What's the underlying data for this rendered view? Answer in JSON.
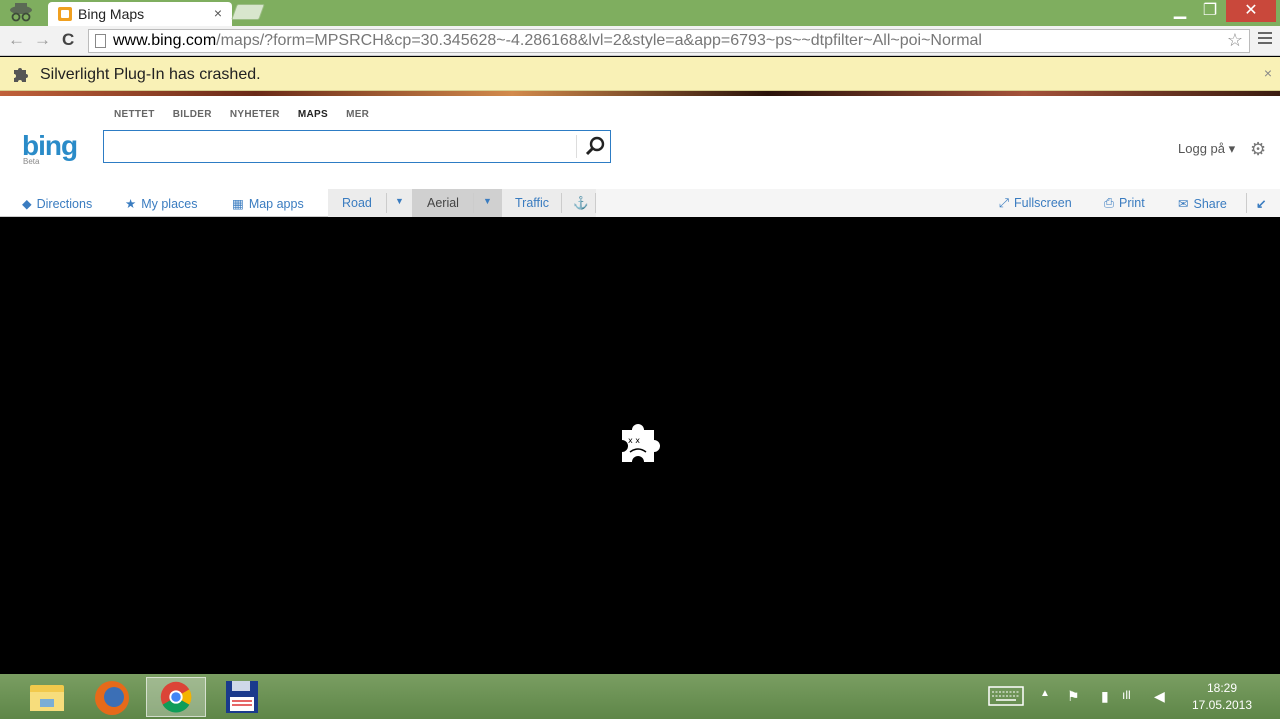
{
  "browser": {
    "tab_title": "Bing Maps",
    "tab_close": "×",
    "url_host": "www.bing.com",
    "url_path": "/maps/?form=MPSRCH&cp=30.345628~-4.286168&lvl=2&style=a&app=6793~ps~~dtpfilter~All~poi~Normal",
    "window_min": "▁",
    "window_max": "❐",
    "window_close": "✕"
  },
  "infobar": {
    "message": "Silverlight Plug-In has crashed.",
    "close": "×"
  },
  "bing": {
    "scopes": [
      "NETTET",
      "BILDER",
      "NYHETER",
      "MAPS",
      "MER"
    ],
    "logo": "bing",
    "logo_sub": "Beta",
    "search_value": "",
    "login": "Logg på ▾"
  },
  "map_toolbar": {
    "directions": "Directions",
    "my_places": "My places",
    "map_apps": "Map apps",
    "road": "Road",
    "aerial": "Aerial",
    "traffic": "Traffic",
    "fullscreen": "Fullscreen",
    "print": "Print",
    "share": "Share"
  },
  "taskbar": {
    "time": "18:29",
    "date": "17.05.2013"
  },
  "colors": {
    "chrome_frame": "#7fae5f",
    "infobar": "#f9f1b6",
    "bing_blue": "#2a8bc8",
    "link_blue": "#3a7cc0"
  }
}
